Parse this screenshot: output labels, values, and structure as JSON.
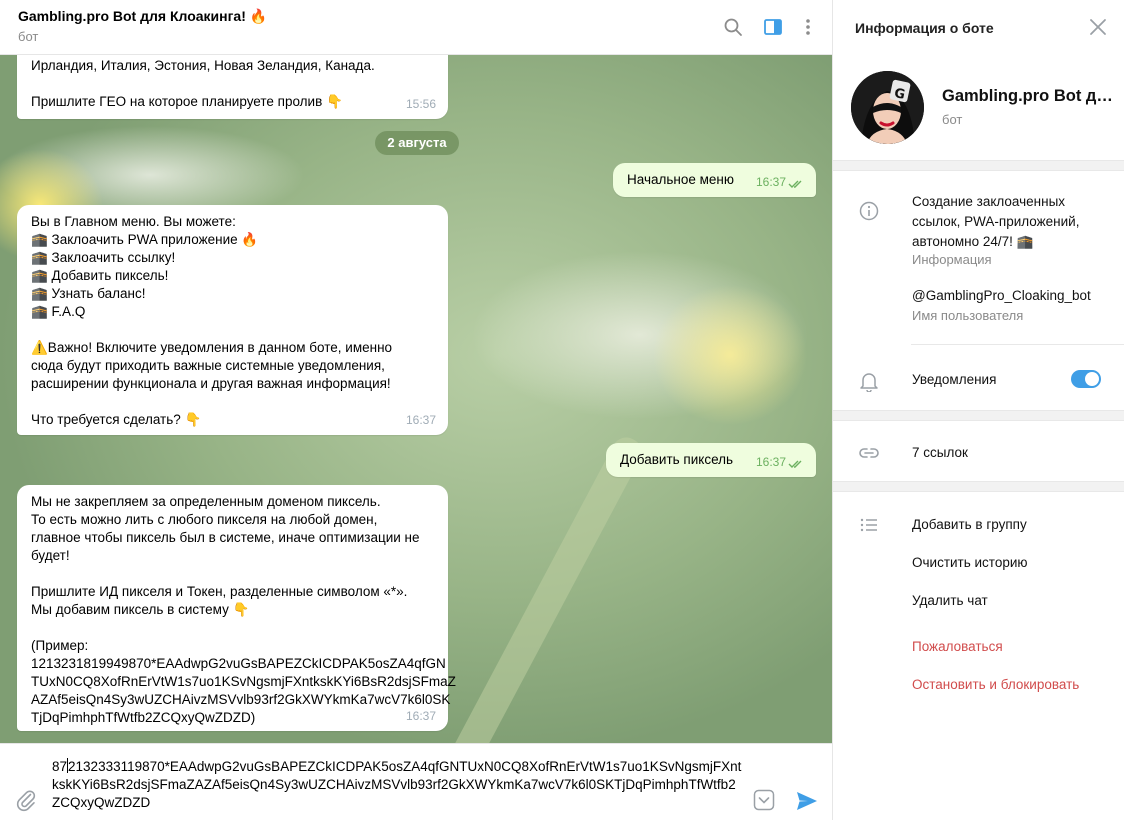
{
  "header": {
    "title": "Gambling.pro Bot для Клоакинга! 🔥",
    "subtitle": "бот"
  },
  "chat": {
    "date_chip": "2 августа",
    "messages": [
      {
        "id": "m1",
        "dir": "in",
        "time": "15:56",
        "lines": [
          "Ирландия, Италия, Эстония, Новая Зеландия, Канада.",
          "",
          "Пришлите ГЕО на которое планируете пролив 👇"
        ]
      },
      {
        "id": "m2",
        "dir": "out",
        "time": "16:37",
        "lines": [
          "Начальное меню"
        ]
      },
      {
        "id": "m3",
        "dir": "in",
        "time": "16:37",
        "lines": [
          "Вы в Главном меню. Вы можете:",
          "🕋 Заклоачить PWA приложение 🔥",
          "🕋 Заклоачить ссылку!",
          "🕋 Добавить пиксель!",
          "🕋 Узнать баланс!",
          "🕋 F.A.Q",
          "",
          "⚠️Важно! Включите уведомления в данном боте, именно",
          "сюда будут приходить важные системные уведомления,",
          "расширении функционала и другая важная информация!",
          "",
          "Что требуется сделать? 👇"
        ]
      },
      {
        "id": "m4",
        "dir": "out",
        "time": "16:37",
        "lines": [
          "Добавить пиксель"
        ]
      },
      {
        "id": "m5",
        "dir": "in",
        "time": "16:37",
        "lines": [
          "Мы не закрепляем за определенным доменом пиксель.",
          "То есть можно лить с любого пикселя на любой домен,",
          "главное чтобы пиксель был в системе, иначе оптимизации не",
          "будет!",
          "",
          "Пришлите ИД пикселя и Токен, разделенные символом «*».",
          "Мы добавим пиксель в систему 👇",
          "",
          "(Пример:",
          "1213231819949870*EAAdwpG2vuGsBAPEZCkICDPAK5osZA4qfGN",
          "TUxN0CQ8XofRnErVtW1s7uo1KSvNgsmjFXntkskKYi6BsR2dsjSFmaZ",
          "AZAf5eisQn4Sy3wUZCHAivzMSVvlb93rf2GkXWYkmKa7wcV7k6l0SK",
          "TjDqPimhphTfWtfb2ZCQxyQwZDZD)"
        ]
      }
    ]
  },
  "composer": {
    "text_before_caret": "87",
    "text_after_caret": "2132333119870*EAAdwpG2vuGsBAPEZCkICDPAK5osZA4qfGNTUxN0CQ8XofRnErVtW1s7uo1KSvNgsmjFXntkskKYi6BsR2dsjSFmaZAZAf5eisQn4Sy3wUZCHAivzMSVvlb93rf2GkXWYkmKa7wcV7k6l0SKTjDqPimhphTfWtfb2ZCQxyQwZDZD"
  },
  "sidebar": {
    "title": "Информация о боте",
    "bot_name": "Gambling.pro Bot для Клоакинга! 🔥",
    "bot_sub": "бот",
    "description": [
      "Создание заклоаченных",
      "ссылок, PWA-приложений,",
      "автономно 24/7! 🕋"
    ],
    "description_caption": "Информация",
    "username": "@GamblingPro_Cloaking_bot",
    "username_caption": "Имя пользователя",
    "notifications_label": "Уведомления",
    "notifications_on": true,
    "links_label": "7 ссылок",
    "actions": {
      "add_to_group": "Добавить в группу",
      "clear_history": "Очистить историю",
      "delete_chat": "Удалить чат",
      "report": "Пожаловаться",
      "stop_block": "Остановить и блокировать"
    }
  },
  "colors": {
    "accent": "#3f9ee6",
    "outgoing_bubble": "#effdde",
    "danger": "#d14c4c"
  }
}
